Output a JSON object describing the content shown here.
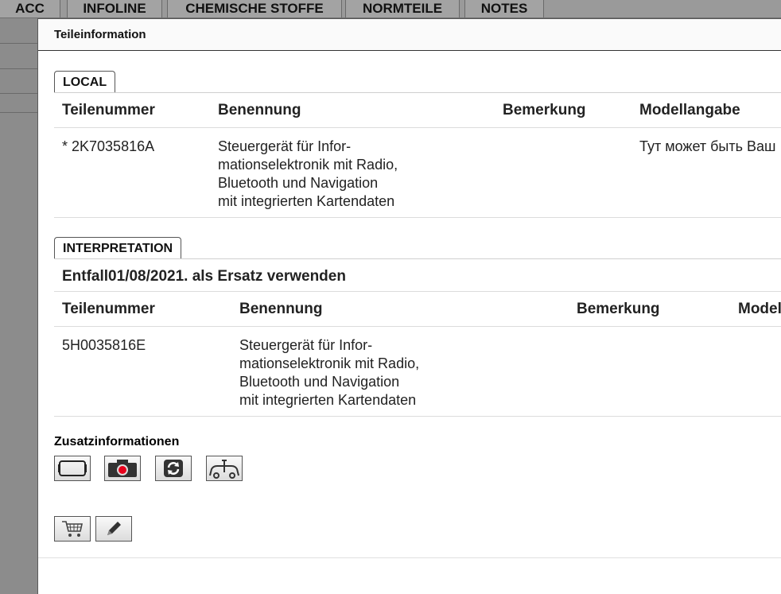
{
  "top_tabs": [
    "ACC",
    "INFOLINE",
    "CHEMISCHE STOFFE",
    "NORMTEILE",
    "NOTES"
  ],
  "dialog": {
    "title": "Teileinformation"
  },
  "local": {
    "tab_label": "LOCAL",
    "headers": {
      "teilenummer": "Teilenummer",
      "benennung": "Benennung",
      "bemerkung": "Bemerkung",
      "modellangabe": "Modellangabe"
    },
    "row": {
      "teilenummer": "* 2K7035816A",
      "benennung_lines": [
        "Steuergerät für Infor-",
        "mationselektronik mit Radio,",
        "Bluetooth und Navigation",
        "mit integrierten Kartendaten"
      ],
      "bemerkung": "",
      "modellangabe": "Тут может быть Ваш"
    }
  },
  "interpretation": {
    "tab_label": "INTERPRETATION",
    "title": "Entfall01/08/2021. als Ersatz verwenden",
    "headers": {
      "teilenummer": "Teilenummer",
      "benennung": "Benennung",
      "bemerkung": "Bemerkung",
      "modell": "Modell"
    },
    "row": {
      "teilenummer": "5H0035816E",
      "benennung_lines": [
        "Steuergerät für Infor-",
        "mationselektronik mit Radio,",
        "Bluetooth und Navigation",
        "mit integrierten Kartendaten"
      ]
    }
  },
  "zusatz": {
    "label": "Zusatzinformationen",
    "icons": [
      "frame-icon",
      "camera-icon",
      "refresh-icon",
      "vehicle-icon"
    ]
  },
  "actions": {
    "icons": [
      "cart-icon",
      "pencil-icon"
    ]
  },
  "colors": {
    "camera_red": "#e8001c"
  }
}
